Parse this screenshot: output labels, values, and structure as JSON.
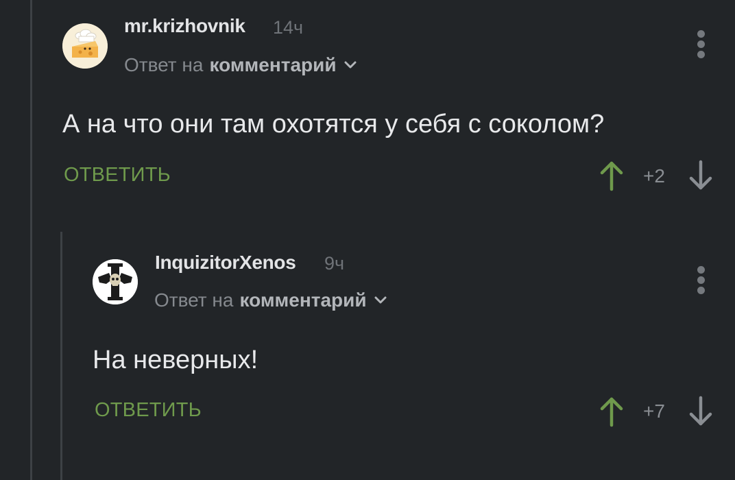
{
  "comments": [
    {
      "username": "mr.krizhovnik",
      "time": "14ч",
      "reply_prefix": "Ответ на",
      "reply_target": "комментарий",
      "text": "А на что они там охотятся у себя с соколом?",
      "reply_label": "ОТВЕТИТЬ",
      "score": "+2"
    },
    {
      "username": "InquizitorXenos",
      "time": "9ч",
      "reply_prefix": "Ответ на",
      "reply_target": "комментарий",
      "text": "На неверных!",
      "reply_label": "ОТВЕТИТЬ",
      "score": "+7"
    }
  ],
  "colors": {
    "background": "#222528",
    "accent_green": "#6f9a4c",
    "thread_line": "#3d4145"
  },
  "icons": {
    "upvote": "arrow-up-icon",
    "downvote": "arrow-down-icon",
    "more": "more-vertical-icon",
    "chevron": "chevron-down-icon"
  }
}
